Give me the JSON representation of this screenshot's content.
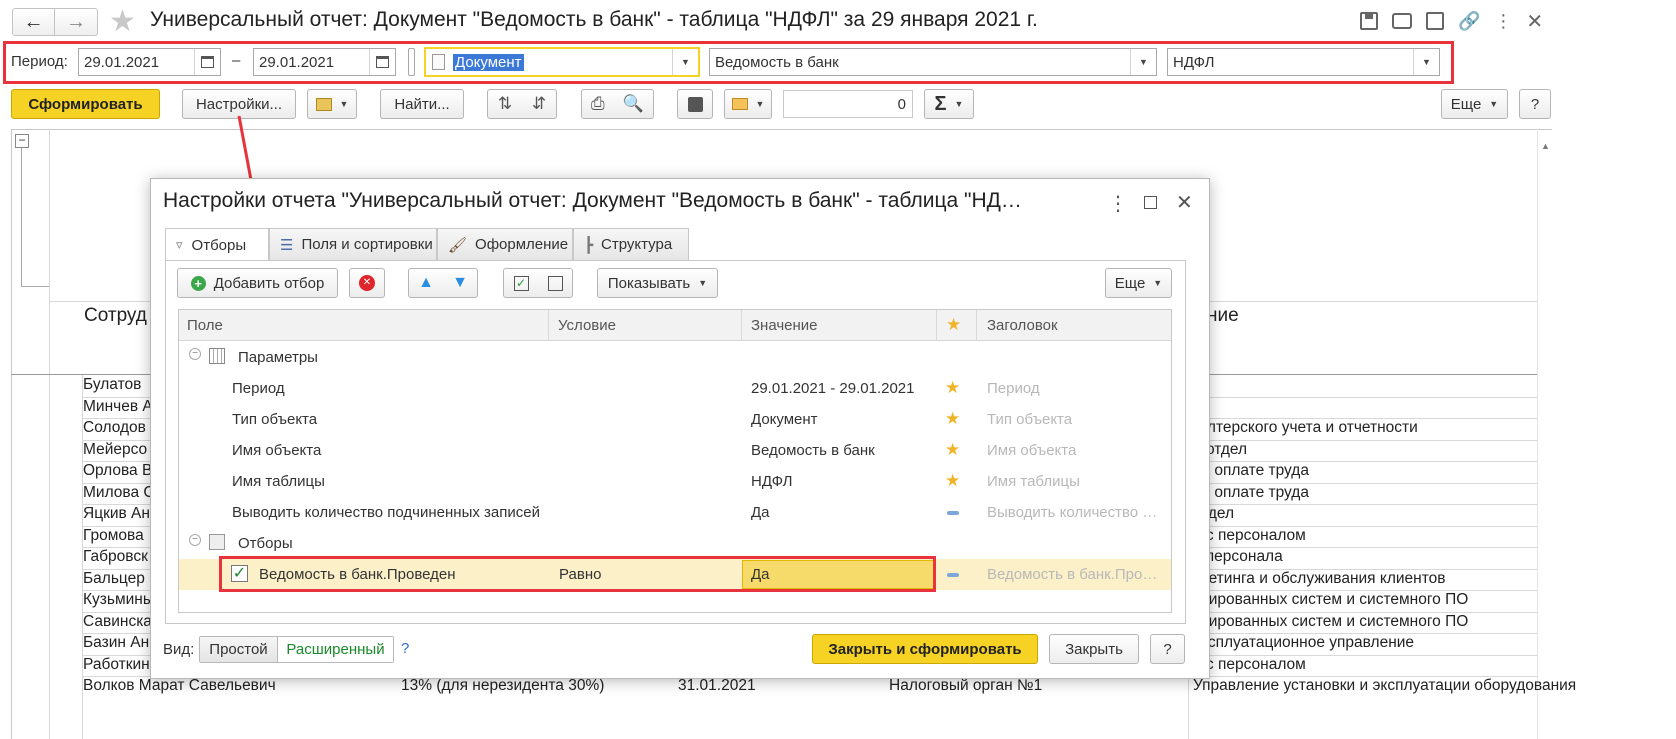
{
  "window": {
    "title": "Универсальный отчет: Документ \"Ведомость в банк\" - таблица \"НДФЛ\" за 29 января 2021 г."
  },
  "filters": {
    "period_label": "Период:",
    "date_from": "29.01.2021",
    "dash": "–",
    "date_to": "29.01.2021",
    "object_type": "Документ",
    "object_name": "Ведомость в банк",
    "table_name": "НДФЛ"
  },
  "toolbar": {
    "generate": "Сформировать",
    "settings": "Настройки...",
    "find": "Найти...",
    "amount_value": "0",
    "sigma": "Σ",
    "more": "Еще",
    "help": "?"
  },
  "report": {
    "header_left": "Сотруд",
    "header_right": "ние",
    "left_rows": [
      "Булатов",
      "Минчев А",
      "Солодов",
      "Мейерсо",
      "Орлова В",
      "Милова С",
      "Яцкив Ан",
      "Громова",
      "Габровск",
      "Бальцер",
      "Кузьмины",
      "Савинска",
      "Базин Ан",
      "Работкин",
      "Волков Марат Савельевич"
    ],
    "right_rows": [
      "",
      "",
      "галтерского учета и отчетности",
      "й отдел",
      "по оплате труда",
      "по оплате труда",
      "отдел",
      "е с персоналом",
      "я персонала",
      "ркетинга и обслуживания клиентов",
      "изированных систем и системного ПО",
      "изированных систем и системного ПО",
      "эксплуатационное управление",
      "е с персоналом",
      "Управление установки и эксплуатации оборудования"
    ],
    "bottom_row": {
      "col2": "13% (для нерезидента 30%)",
      "col3": "31.01.2021",
      "col4": "Налоговый орган №1"
    }
  },
  "dialog": {
    "title": "Настройки отчета \"Универсальный отчет: Документ \"Ведомость в банк\" - таблица \"НД…",
    "tabs": [
      "Отборы",
      "Поля и сортировки",
      "Оформление",
      "Структура"
    ],
    "add_filter": "Добавить отбор",
    "show": "Показывать",
    "more": "Еще",
    "columns": {
      "field": "Поле",
      "condition": "Условие",
      "value": "Значение",
      "title": "Заголовок"
    },
    "groups": {
      "params": "Параметры",
      "filters": "Отборы"
    },
    "params": [
      {
        "field": "Период",
        "value": "29.01.2021 - 29.01.2021",
        "title": "Период"
      },
      {
        "field": "Тип объекта",
        "value": "Документ",
        "title": "Тип объекта"
      },
      {
        "field": "Имя объекта",
        "value": "Ведомость в банк",
        "title": "Имя объекта"
      },
      {
        "field": "Имя таблицы",
        "value": "НДФЛ",
        "title": "Имя таблицы"
      },
      {
        "field": "Выводить количество подчиненных записей",
        "value": "Да",
        "title": "Выводить количество …"
      }
    ],
    "filter_row": {
      "field": "Ведомость в банк.Проведен",
      "condition": "Равно",
      "value": "Да",
      "title": "Ведомость в банк.Про…"
    },
    "view_label": "Вид:",
    "view_simple": "Простой",
    "view_extended": "Расширенный",
    "view_help": "?",
    "close_generate": "Закрыть и сформировать",
    "close": "Закрыть",
    "help": "?"
  },
  "colors": {
    "accent_yellow": "#f5d224",
    "highlight_red": "#e8323c",
    "selected_row": "#fbf0c8",
    "star": "#f0b429",
    "green_text": "#1a8a2a"
  }
}
